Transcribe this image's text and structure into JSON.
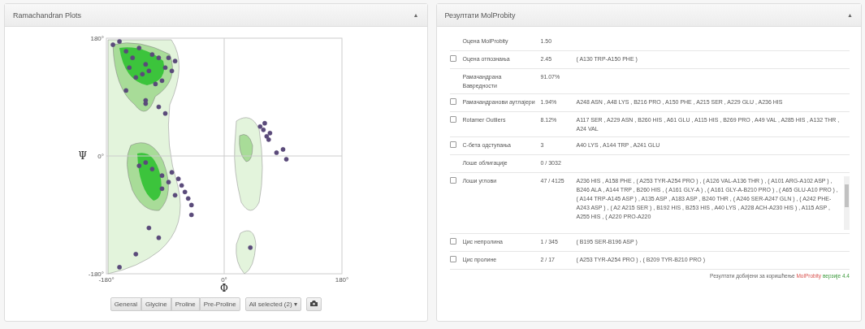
{
  "left_panel": {
    "title": "Ramachandran Plots",
    "collapse_icon": "▲",
    "chart_data": {
      "type": "scatter",
      "xlabel": "Φ",
      "ylabel": "Ψ",
      "xlim": [
        -180,
        180
      ],
      "ylim": [
        -180,
        180
      ],
      "xticks": [
        {
          "value": -180,
          "label": "-180°"
        },
        {
          "value": 0,
          "label": "0°"
        },
        {
          "value": 180,
          "label": "180°"
        }
      ],
      "yticks": [
        {
          "value": -180,
          "label": "-180°"
        },
        {
          "value": 0,
          "label": "0°"
        },
        {
          "value": 180,
          "label": "180°"
        }
      ],
      "x": [
        -150,
        -140,
        -130,
        -120,
        -110,
        -100,
        -90,
        -80,
        -75,
        -135,
        -125,
        -115,
        -105,
        -95,
        -85,
        -145,
        -160,
        -170,
        -120,
        -100,
        -90,
        -80,
        -70,
        -65,
        -60,
        -75,
        -85,
        -95,
        -110,
        -120,
        -130,
        -95,
        -55,
        -50,
        55,
        60,
        65,
        70,
        62,
        68,
        80,
        90,
        95,
        40,
        -150,
        -115,
        -100,
        -135,
        -160,
        -120,
        -50
      ],
      "series": [
        {
          "color": "#5a4a7a",
          "values": [
            160,
            150,
            165,
            140,
            155,
            150,
            135,
            130,
            145,
            120,
            125,
            130,
            110,
            115,
            150,
            135,
            175,
            170,
            85,
            75,
            65,
            -25,
            -35,
            -45,
            -55,
            -60,
            -40,
            -30,
            -20,
            -10,
            -15,
            -50,
            -65,
            -75,
            45,
            40,
            30,
            35,
            50,
            25,
            5,
            10,
            -5,
            -140,
            100,
            -110,
            -125,
            -150,
            -170,
            80,
            -90
          ]
        }
      ]
    }
  },
  "filters": [
    {
      "label": "General"
    },
    {
      "label": "Glycine"
    },
    {
      "label": "Proline"
    },
    {
      "label": "Pre-Proline"
    }
  ],
  "selector": {
    "label": "All selected (2)",
    "caret": "▾"
  },
  "right_panel": {
    "title": "Резултати MolProbity",
    "collapse_icon": "▲",
    "rows": [
      {
        "kind": "plain",
        "label": "Оцена MolProbity",
        "value": "1.50"
      },
      {
        "kind": "checkable",
        "checked": false,
        "label": "Оцена отпознања",
        "value": "2.45",
        "details": "( A130 TRP-A150 PHE )"
      },
      {
        "kind": "plain",
        "label": "Рамачандрана Вавредности",
        "value": "91.07%"
      },
      {
        "kind": "checkable",
        "checked": false,
        "label": "Рамачандранови аутлајери",
        "value": "1.94%",
        "details": "A248 ASN , A48 LYS , B216 PRO , A150 PHE , A215 SER , A229 GLU , A236 HIS"
      },
      {
        "kind": "checkable",
        "checked": false,
        "label": "Rotamer Outliers",
        "value": "8.12%",
        "details": "A117 SER , A229 ASN , B260 HIS , A61 GLU , A115 HIS , B269 PRO , A49 VAL , A285 HIS , A132 THR , A24 VAL"
      },
      {
        "kind": "checkable",
        "checked": false,
        "label": "C-бета одступања",
        "value": "3",
        "details": "A40 LYS , A144 TRP , A241 GLU"
      },
      {
        "kind": "plain",
        "label": "Лоше облигације",
        "value": "0 / 3032"
      },
      {
        "kind": "scroll",
        "checked": false,
        "label": "Лоши углови",
        "value": "47 / 4125",
        "details": "A236 HIS , A158 PHE , ( A253 TYR-A254 PRO ) , ( A126 VAL-A136 THR ) , ( A101 ARG-A102 ASP ) , B246 ALA , A144 TRP , B260 HIS , ( A161 GLY-A ) , ( A161 GLY-A-B210 PRO ) , ( A65 GLU-A10 PRO ) , ( A144 TRP-A145 ASP ) , A135 ASP , A183 ASP , B240 THR , ( A246 SER-A247 GLN ) , ( A242 PHE-A243 ASP ) , ( A2 A215 SER ) , B192 HIS , B253 HIS , A40 LYS , A228 ACH-A230 HIS ) , A115 ASP , A255 HIS , ( A220 PRO-A220"
      },
      {
        "kind": "checkable",
        "checked": false,
        "label": "Цис непролина",
        "value": "1 / 345",
        "details": "( B195 SER-B196 ASP )"
      },
      {
        "kind": "checkable",
        "checked": false,
        "label": "Цис пролине",
        "value": "2 / 17",
        "details": "( A253 TYR-A254 PRO ) , ( B209 TYR-B210 PRO )"
      }
    ],
    "footer": {
      "text": "Резултати добијени за коришћење",
      "link": "MolProbity",
      "version": "верзије 4.4"
    }
  }
}
